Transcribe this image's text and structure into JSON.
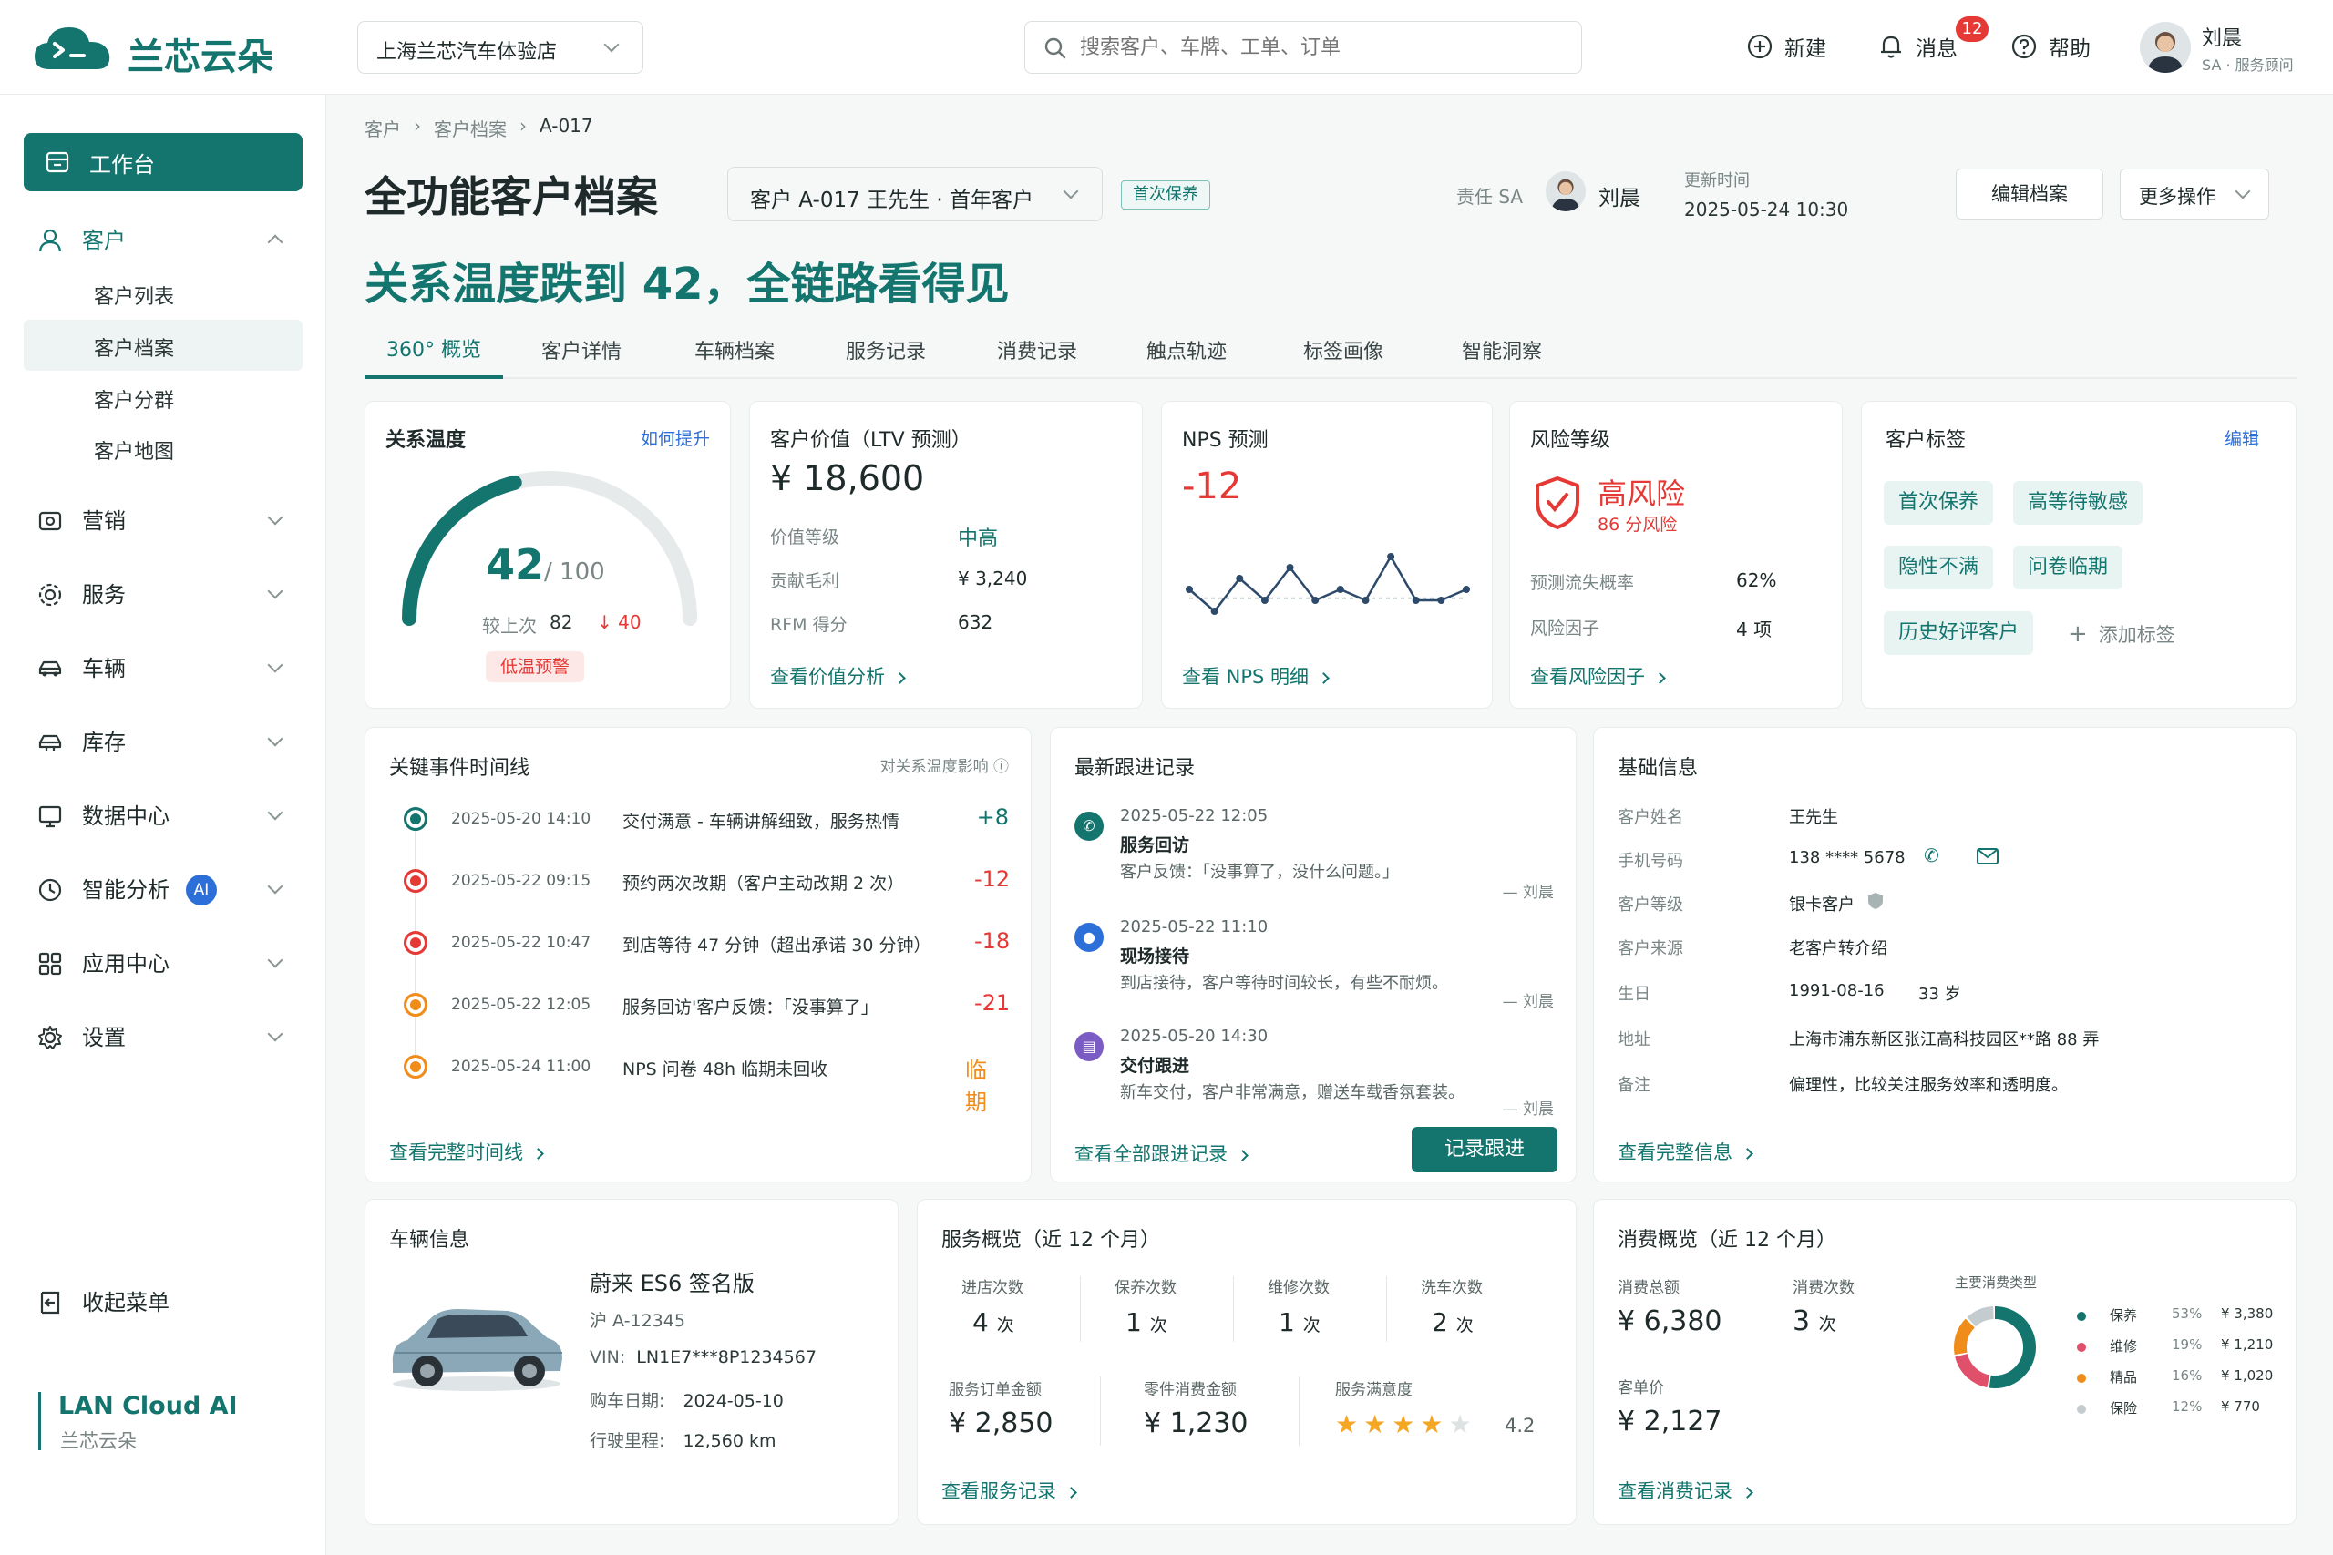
{
  "brand": {
    "name": "兰芯云朵",
    "footer_title": "LAN Cloud AI",
    "footer_sub": "兰芯云朵"
  },
  "topbar": {
    "store": "上海兰芯汽车体验店",
    "search_placeholder": "搜索客户、车牌、工单、订单",
    "new_label": "新建",
    "msg_label": "消息",
    "msg_count": "12",
    "help_label": "帮助",
    "user_name": "刘晨",
    "user_role": "SA · 服务顾问"
  },
  "sidebar": {
    "workbench": "工作台",
    "customer": "客户",
    "customer_sub": [
      "客户列表",
      "客户档案",
      "客户分群",
      "客户地图"
    ],
    "items": [
      "营销",
      "服务",
      "车辆",
      "库存",
      "数据中心",
      "智能分析",
      "应用中心",
      "设置"
    ],
    "ai_badge": "AI",
    "collapse": "收起菜单"
  },
  "breadcrumb": [
    "客户",
    "客户档案",
    "A-017"
  ],
  "header": {
    "title": "全功能客户档案",
    "customer_select": "客户 A-017 王先生 · 首年客户",
    "status_tag": "首次保养",
    "owner_label": "责任 SA",
    "owner_name": "刘晨",
    "updated_label": "更新时间",
    "updated_value": "2025-05-24 10:30",
    "edit_btn": "编辑档案",
    "more_btn": "更多操作",
    "headline": "关系温度跌到 42，全链路看得见"
  },
  "tabs": [
    "360° 概览",
    "客户详情",
    "车辆档案",
    "服务记录",
    "消费记录",
    "触点轨迹",
    "标签画像",
    "智能洞察"
  ],
  "temp_card": {
    "title": "关系温度",
    "link": "如何提升",
    "value": "42",
    "max": "/ 100",
    "compare_label": "较上次",
    "compare_value": "82",
    "delta": "40",
    "alert": "低温预警",
    "value_num": 42
  },
  "value_card": {
    "title": "客户价值（LTV 预测）",
    "amount": "¥ 18,600",
    "rows": [
      {
        "label": "价值等级",
        "value": "中高"
      },
      {
        "label": "贡献毛利",
        "value": "¥ 3,240"
      },
      {
        "label": "RFM 得分",
        "value": "632"
      }
    ],
    "link": "查看价值分析"
  },
  "nps_card": {
    "title": "NPS 预测",
    "value": "-12",
    "link": "查看 NPS 明细"
  },
  "risk_card": {
    "title": "风险等级",
    "level": "高风险",
    "score": "86 分风险",
    "rows": [
      {
        "label": "预测流失概率",
        "value": "62%"
      },
      {
        "label": "风险因子",
        "value": "4 项"
      }
    ],
    "link": "查看风险因子"
  },
  "tags_card": {
    "title": "客户标签",
    "edit": "编辑",
    "tags": [
      "首次保养",
      "高等待敏感",
      "隐性不满",
      "问卷临期",
      "历史好评客户"
    ],
    "add": "添加标签"
  },
  "timeline": {
    "title": "关键事件时间线",
    "hint": "对关系温度影响",
    "events": [
      {
        "time": "2025-05-20 14:10",
        "text": "交付满意 - 车辆讲解细致，服务热情",
        "delta": "+8",
        "color": "#13756e"
      },
      {
        "time": "2025-05-22 09:15",
        "text": "预约两次改期（客户主动改期 2 次）",
        "delta": "-12",
        "color": "#e53935"
      },
      {
        "time": "2025-05-22 10:47",
        "text": "到店等待 47 分钟（超出承诺 30 分钟）",
        "delta": "-18",
        "color": "#e53935"
      },
      {
        "time": "2025-05-22 12:05",
        "text": "服务回访'客户反馈：「没事算了」",
        "delta": "-21",
        "color": "#e53935"
      },
      {
        "time": "2025-05-24 11:00",
        "text": "NPS 问卷 48h 临期未回收",
        "delta": "临期",
        "color": "#f08c1a"
      }
    ],
    "link": "查看完整时间线"
  },
  "followup": {
    "title": "最新跟进记录",
    "records": [
      {
        "time": "2025-05-22 12:05",
        "type": "服务回访",
        "desc": "客户反馈：「没事算了，没什么问题。」",
        "author": "— 刘晨",
        "color": "#13756e"
      },
      {
        "time": "2025-05-22 11:10",
        "type": "现场接待",
        "desc": "到店接待，客户等待时间较长，有些不耐烦。",
        "author": "— 刘晨",
        "color": "#2d6fd8"
      },
      {
        "time": "2025-05-20 14:30",
        "type": "交付跟进",
        "desc": "新车交付，客户非常满意，赠送车载香氛套装。",
        "author": "— 刘晨",
        "color": "#7b5cc4"
      }
    ],
    "link": "查看全部跟进记录",
    "button": "记录跟进"
  },
  "basic": {
    "title": "基础信息",
    "rows": [
      {
        "label": "客户姓名",
        "value": "王先生"
      },
      {
        "label": "手机号码",
        "value": "138 **** 5678"
      },
      {
        "label": "客户等级",
        "value": "银卡客户"
      },
      {
        "label": "客户来源",
        "value": "老客户转介绍"
      },
      {
        "label": "生日",
        "value": "1991-08-16",
        "extra": "33 岁"
      },
      {
        "label": "地址",
        "value": "上海市浦东新区张江高科技园区**路 88 弄"
      },
      {
        "label": "备注",
        "value": "偏理性，比较关注服务效率和透明度。"
      }
    ],
    "link": "查看完整信息"
  },
  "vehicle": {
    "title": "车辆信息",
    "model": "蔚来 ES6 签名版",
    "plate": "沪 A-12345",
    "vin_label": "VIN:",
    "vin": "LN1E7***8P1234567",
    "buy_label": "购车日期:",
    "buy": "2024-05-10",
    "mile_label": "行驶里程:",
    "mile": "12,560 km"
  },
  "service": {
    "title": "服务概览（近 12 个月）",
    "counts": [
      {
        "label": "进店次数",
        "value": "4",
        "unit": "次"
      },
      {
        "label": "保养次数",
        "value": "1",
        "unit": "次"
      },
      {
        "label": "维修次数",
        "value": "1",
        "unit": "次"
      },
      {
        "label": "洗车次数",
        "value": "2",
        "unit": "次"
      }
    ],
    "money": [
      {
        "label": "服务订单金额",
        "value": "¥ 2,850"
      },
      {
        "label": "零件消费金额",
        "value": "¥ 1,230"
      }
    ],
    "sat_label": "服务满意度",
    "sat_value": "4.2",
    "rating": 4.2,
    "link": "查看服务记录"
  },
  "consume": {
    "title": "消费概览（近 12 个月）",
    "total_label": "消费总额",
    "total": "¥ 6,380",
    "count_label": "消费次数",
    "count": "3",
    "count_unit": "次",
    "avg_label": "客单价",
    "avg": "¥ 2,127",
    "type_label": "主要消费类型",
    "link": "查看消费记录"
  },
  "chart_data": {
    "type": "pie",
    "categories": [
      "保养",
      "维修",
      "精品",
      "保险"
    ],
    "values": [
      53,
      19,
      16,
      12
    ],
    "amounts": [
      "¥ 3,380",
      "¥ 1,210",
      "¥ 1,020",
      "¥ 770"
    ],
    "colors": [
      "#13756e",
      "#e0506a",
      "#f08c1a",
      "#c5ccd0"
    ],
    "percent_labels": [
      "53%",
      "19%",
      "16%",
      "12%"
    ]
  },
  "nps_chart": {
    "type": "line",
    "values": [
      3,
      1,
      4,
      2,
      5,
      2,
      3,
      2,
      6,
      2,
      2,
      3
    ],
    "baseline": 2.2
  }
}
